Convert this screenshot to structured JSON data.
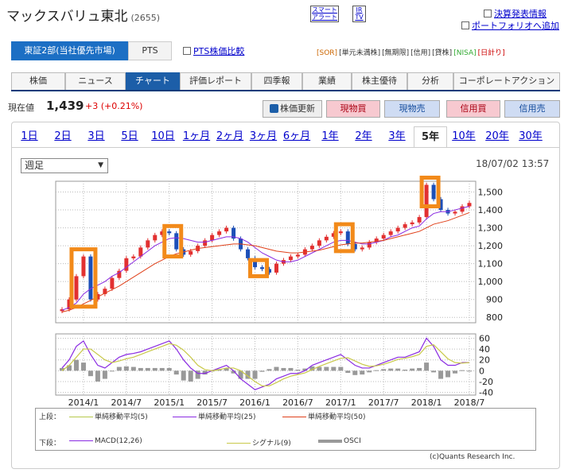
{
  "header": {
    "title": "マックスバリュ東北",
    "code": "(2655)",
    "smart_alert": [
      "スマート",
      "アラート"
    ],
    "ir_tv": [
      "IR",
      "TV"
    ],
    "links": [
      "決算発表情報",
      "ポートフォリオへ追加"
    ]
  },
  "market": {
    "selected": "東証2部(当社優先市場)",
    "pts": "PTS",
    "compare_link": "PTS株価比較",
    "tags": [
      "[SOR]",
      "[単元未満株]",
      "[無期限]",
      "[信用]",
      "[貸株]",
      "[NISA]",
      "[日計り]"
    ]
  },
  "tabs": [
    "株価",
    "ニュース",
    "チャート",
    "評価レポート",
    "四季報",
    "業績",
    "株主優待",
    "分析",
    "コーポレートアクション"
  ],
  "price": {
    "label": "現在値",
    "value": "1,439",
    "change": "+3 (+0.21%)"
  },
  "buttons": {
    "refresh": "株価更新",
    "genbutsu_buy": "現物買",
    "genbutsu_sell": "現物売",
    "shinyo_buy": "信用買",
    "shinyo_sell": "信用売"
  },
  "periods": [
    "1日",
    "2日",
    "3日",
    "5日",
    "10日",
    "1ヶ月",
    "2ヶ月",
    "3ヶ月",
    "6ヶ月",
    "1年",
    "2年",
    "3年",
    "5年",
    "10年",
    "20年",
    "30年"
  ],
  "selected_period": "5年",
  "interval": "週足",
  "timestamp": "18/07/02 13:57",
  "legend": {
    "upper_label": "上段：",
    "lower_label": "下段：",
    "upper": [
      {
        "name": "単純移動平均(5)",
        "color": "#b5c94a"
      },
      {
        "name": "単純移動平均(25)",
        "color": "#8a2be2"
      },
      {
        "name": "単純移動平均(50)",
        "color": "#e0401a"
      }
    ],
    "lower": [
      {
        "name": "MACD(12,26)",
        "color": "#8a2be2"
      },
      {
        "name": "シグナル(9)",
        "color": "#c9c94a"
      },
      {
        "name": "OSCI",
        "color": "#999999"
      }
    ]
  },
  "credit": "(c)Quants Research Inc.",
  "colors": {
    "up": "#e23030",
    "down": "#1c4fb8",
    "highlight": "#f28a1a"
  },
  "chart_data": [
    {
      "type": "line",
      "title": "",
      "x": [
        "2013/10",
        "2013/11",
        "2013/12",
        "2014/1",
        "2014/2",
        "2014/3",
        "2014/4",
        "2014/5",
        "2014/6",
        "2014/7",
        "2014/8",
        "2014/9",
        "2014/10",
        "2014/11",
        "2014/12",
        "2015/1",
        "2015/2",
        "2015/3",
        "2015/4",
        "2015/5",
        "2015/6",
        "2015/7",
        "2015/8",
        "2015/9",
        "2015/10",
        "2015/11",
        "2015/12",
        "2016/1",
        "2016/2",
        "2016/3",
        "2016/4",
        "2016/5",
        "2016/6",
        "2016/7",
        "2016/8",
        "2016/9",
        "2016/10",
        "2016/11",
        "2016/12",
        "2017/1",
        "2017/2",
        "2017/3",
        "2017/4",
        "2017/5",
        "2017/6",
        "2017/7",
        "2017/8",
        "2017/9",
        "2017/10",
        "2017/11",
        "2017/12",
        "2018/1",
        "2018/2",
        "2018/3",
        "2018/4",
        "2018/5",
        "2018/6",
        "2018/7"
      ],
      "series": [
        {
          "name": "",
          "values": [
            845,
            900,
            1030,
            1140,
            900,
            930,
            960,
            1020,
            1060,
            1130,
            1140,
            1190,
            1230,
            1260,
            1280,
            1270,
            1180,
            1150,
            1170,
            1200,
            1230,
            1260,
            1280,
            1300,
            1240,
            1180,
            1130,
            1080,
            1070,
            1050,
            1100,
            1120,
            1140,
            1150,
            1180,
            1200,
            1230,
            1250,
            1270,
            1280,
            1210,
            1180,
            1190,
            1220,
            1240,
            1260,
            1280,
            1300,
            1320,
            1330,
            1360,
            1540,
            1460,
            1400,
            1380,
            1390,
            1420,
            1439
          ]
        },
        {
          "name": "単純移動平均(25)",
          "values": [
            840,
            855,
            880,
            930,
            960,
            980,
            1000,
            1030,
            1050,
            1080,
            1110,
            1140,
            1170,
            1200,
            1220,
            1240,
            1245,
            1240,
            1230,
            1220,
            1220,
            1230,
            1240,
            1250,
            1250,
            1240,
            1220,
            1190,
            1160,
            1140,
            1120,
            1110,
            1110,
            1120,
            1140,
            1160,
            1180,
            1200,
            1220,
            1230,
            1230,
            1220,
            1210,
            1210,
            1220,
            1230,
            1250,
            1260,
            1280,
            1300,
            1310,
            1350,
            1380,
            1390,
            1390,
            1400,
            1410,
            1420
          ]
        },
        {
          "name": "単純移動平均(50)",
          "values": [
            830,
            840,
            855,
            875,
            895,
            915,
            935,
            955,
            975,
            1000,
            1025,
            1050,
            1075,
            1100,
            1120,
            1140,
            1155,
            1165,
            1175,
            1185,
            1190,
            1195,
            1200,
            1205,
            1210,
            1210,
            1205,
            1200,
            1190,
            1180,
            1170,
            1165,
            1160,
            1160,
            1165,
            1170,
            1175,
            1185,
            1195,
            1205,
            1210,
            1215,
            1215,
            1220,
            1225,
            1230,
            1240,
            1250,
            1260,
            1270,
            1280,
            1300,
            1320,
            1330,
            1340,
            1355,
            1370,
            1385
          ]
        }
      ],
      "ylim": [
        770,
        1560
      ],
      "yticks": [
        800,
        900,
        1000,
        1100,
        1200,
        1300,
        1400,
        1500
      ],
      "ytick_labels": [
        "800",
        "900",
        "1,000",
        "1,100",
        "1,200",
        "1,300",
        "1,400",
        "1,500"
      ],
      "xtick_labels": [
        "2014/1",
        "2014/7",
        "2015/1",
        "2015/7",
        "2016/1",
        "2016/7",
        "2017/1",
        "2017/7",
        "2018/1",
        "2018/7"
      ],
      "highlight_ranges": [
        [
          "2013/12",
          "2014/2"
        ],
        [
          "2015/1",
          "2015/2"
        ],
        [
          "2016/1",
          "2016/2"
        ],
        [
          "2017/1",
          "2017/2"
        ],
        [
          "2018/1",
          "2018/2"
        ]
      ],
      "grid": true
    },
    {
      "type": "line",
      "title": "",
      "x": [
        "2013/10",
        "2013/11",
        "2013/12",
        "2014/1",
        "2014/2",
        "2014/3",
        "2014/4",
        "2014/5",
        "2014/6",
        "2014/7",
        "2014/8",
        "2014/9",
        "2014/10",
        "2014/11",
        "2014/12",
        "2015/1",
        "2015/2",
        "2015/3",
        "2015/4",
        "2015/5",
        "2015/6",
        "2015/7",
        "2015/8",
        "2015/9",
        "2015/10",
        "2015/11",
        "2015/12",
        "2016/1",
        "2016/2",
        "2016/3",
        "2016/4",
        "2016/5",
        "2016/6",
        "2016/7",
        "2016/8",
        "2016/9",
        "2016/10",
        "2016/11",
        "2016/12",
        "2017/1",
        "2017/2",
        "2017/3",
        "2017/4",
        "2017/5",
        "2017/6",
        "2017/7",
        "2017/8",
        "2017/9",
        "2017/10",
        "2017/11",
        "2017/12",
        "2018/1",
        "2018/2",
        "2018/3",
        "2018/4",
        "2018/5",
        "2018/6",
        "2018/7"
      ],
      "series": [
        {
          "name": "MACD(12,26)",
          "values": [
            5,
            20,
            45,
            55,
            30,
            10,
            5,
            15,
            25,
            30,
            32,
            35,
            40,
            45,
            50,
            55,
            40,
            20,
            5,
            -5,
            -5,
            0,
            5,
            10,
            0,
            -15,
            -25,
            -35,
            -30,
            -25,
            -15,
            -10,
            -5,
            -5,
            0,
            10,
            15,
            20,
            25,
            30,
            20,
            10,
            5,
            5,
            10,
            15,
            20,
            25,
            25,
            30,
            35,
            60,
            45,
            20,
            10,
            10,
            15,
            15
          ]
        },
        {
          "name": "シグナル(9)",
          "values": [
            0,
            10,
            25,
            40,
            40,
            30,
            20,
            15,
            18,
            22,
            25,
            30,
            35,
            40,
            45,
            50,
            47,
            38,
            25,
            10,
            2,
            0,
            2,
            5,
            5,
            0,
            -10,
            -20,
            -28,
            -28,
            -22,
            -15,
            -10,
            -7,
            -4,
            2,
            8,
            13,
            18,
            23,
            24,
            18,
            12,
            8,
            9,
            12,
            16,
            21,
            23,
            26,
            30,
            45,
            48,
            35,
            22,
            15,
            14,
            15
          ]
        },
        {
          "name": "OSCI",
          "values": [
            5,
            10,
            20,
            15,
            -10,
            -20,
            -15,
            0,
            7,
            8,
            7,
            5,
            5,
            5,
            5,
            5,
            -7,
            -18,
            -20,
            -15,
            -7,
            0,
            3,
            5,
            -5,
            -15,
            -15,
            -15,
            -2,
            3,
            7,
            5,
            5,
            2,
            4,
            8,
            7,
            7,
            7,
            7,
            -4,
            -8,
            -7,
            -3,
            1,
            3,
            4,
            4,
            2,
            4,
            5,
            15,
            -3,
            -15,
            -12,
            -5,
            1,
            0
          ]
        }
      ],
      "ylim": [
        -45,
        68
      ],
      "yticks": [
        -40,
        -20,
        0,
        20,
        40,
        60
      ],
      "ytick_labels": [
        "-40",
        "-20",
        "0",
        "20",
        "40",
        "60"
      ],
      "xtick_labels": [
        "2014/1",
        "2014/7",
        "2015/1",
        "2015/7",
        "2016/1",
        "2016/7",
        "2017/1",
        "2017/7",
        "2018/1",
        "2018/7"
      ],
      "grid": true
    }
  ]
}
